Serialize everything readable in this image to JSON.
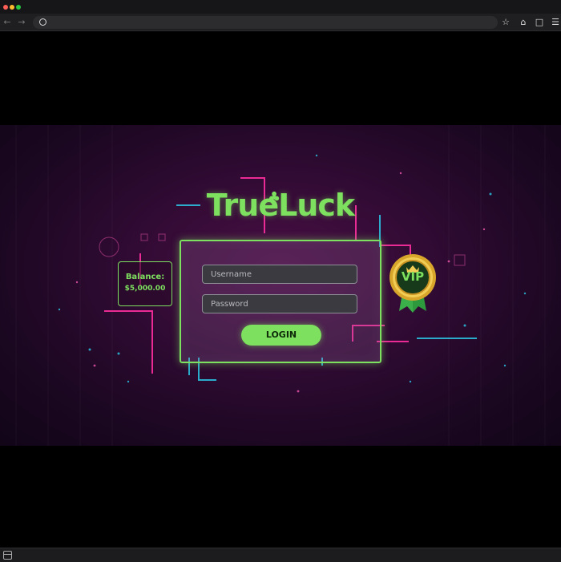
{
  "browser": {
    "back_icon": "arrow-left-icon",
    "forward_icon": "arrow-right-icon",
    "address": "",
    "toolbar_icons": [
      "star-icon",
      "extensions-icon",
      "tabs-icon",
      "menu-icon"
    ]
  },
  "game": {
    "logo_text": "True",
    "logo_text_2": "Luck",
    "balance_label": "Balance:",
    "balance_amount": "$5,000.00",
    "username_placeholder": "Username",
    "password_placeholder": "Password",
    "login_label": "LOGIN",
    "vip_label": "VIP",
    "colors": {
      "accent": "#7ee05f",
      "pink": "#ff2fa0",
      "cyan": "#2bc8e6",
      "background": "#2c0a30"
    }
  }
}
